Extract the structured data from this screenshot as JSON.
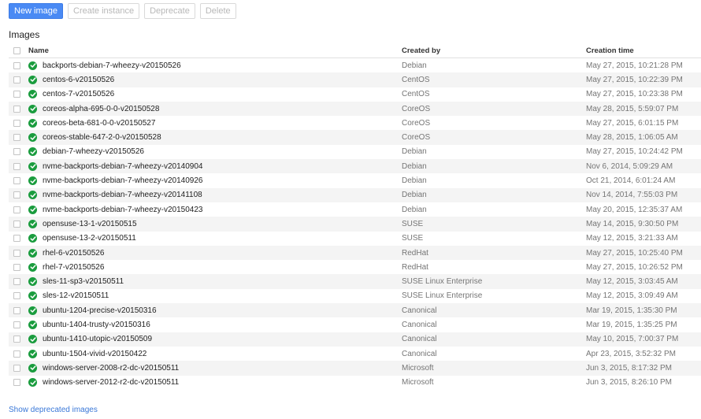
{
  "toolbar": {
    "new_image": "New image",
    "create_instance": "Create instance",
    "deprecate": "Deprecate",
    "delete": "Delete"
  },
  "section_title": "Images",
  "table": {
    "headers": {
      "name": "Name",
      "created_by": "Created by",
      "creation_time": "Creation time"
    },
    "rows": [
      {
        "name": "backports-debian-7-wheezy-v20150526",
        "created_by": "Debian",
        "time": "May 27, 2015, 10:21:28 PM"
      },
      {
        "name": "centos-6-v20150526",
        "created_by": "CentOS",
        "time": "May 27, 2015, 10:22:39 PM"
      },
      {
        "name": "centos-7-v20150526",
        "created_by": "CentOS",
        "time": "May 27, 2015, 10:23:38 PM"
      },
      {
        "name": "coreos-alpha-695-0-0-v20150528",
        "created_by": "CoreOS",
        "time": "May 28, 2015, 5:59:07 PM"
      },
      {
        "name": "coreos-beta-681-0-0-v20150527",
        "created_by": "CoreOS",
        "time": "May 27, 2015, 6:01:15 PM"
      },
      {
        "name": "coreos-stable-647-2-0-v20150528",
        "created_by": "CoreOS",
        "time": "May 28, 2015, 1:06:05 AM"
      },
      {
        "name": "debian-7-wheezy-v20150526",
        "created_by": "Debian",
        "time": "May 27, 2015, 10:24:42 PM"
      },
      {
        "name": "nvme-backports-debian-7-wheezy-v20140904",
        "created_by": "Debian",
        "time": "Nov 6, 2014, 5:09:29 AM"
      },
      {
        "name": "nvme-backports-debian-7-wheezy-v20140926",
        "created_by": "Debian",
        "time": "Oct 21, 2014, 6:01:24 AM"
      },
      {
        "name": "nvme-backports-debian-7-wheezy-v20141108",
        "created_by": "Debian",
        "time": "Nov 14, 2014, 7:55:03 PM"
      },
      {
        "name": "nvme-backports-debian-7-wheezy-v20150423",
        "created_by": "Debian",
        "time": "May 20, 2015, 12:35:37 AM"
      },
      {
        "name": "opensuse-13-1-v20150515",
        "created_by": "SUSE",
        "time": "May 14, 2015, 9:30:50 PM"
      },
      {
        "name": "opensuse-13-2-v20150511",
        "created_by": "SUSE",
        "time": "May 12, 2015, 3:21:33 AM"
      },
      {
        "name": "rhel-6-v20150526",
        "created_by": "RedHat",
        "time": "May 27, 2015, 10:25:40 PM"
      },
      {
        "name": "rhel-7-v20150526",
        "created_by": "RedHat",
        "time": "May 27, 2015, 10:26:52 PM"
      },
      {
        "name": "sles-11-sp3-v20150511",
        "created_by": "SUSE Linux Enterprise",
        "time": "May 12, 2015, 3:03:45 AM"
      },
      {
        "name": "sles-12-v20150511",
        "created_by": "SUSE Linux Enterprise",
        "time": "May 12, 2015, 3:09:49 AM"
      },
      {
        "name": "ubuntu-1204-precise-v20150316",
        "created_by": "Canonical",
        "time": "Mar 19, 2015, 1:35:30 PM"
      },
      {
        "name": "ubuntu-1404-trusty-v20150316",
        "created_by": "Canonical",
        "time": "Mar 19, 2015, 1:35:25 PM"
      },
      {
        "name": "ubuntu-1410-utopic-v20150509",
        "created_by": "Canonical",
        "time": "May 10, 2015, 7:00:37 PM"
      },
      {
        "name": "ubuntu-1504-vivid-v20150422",
        "created_by": "Canonical",
        "time": "Apr 23, 2015, 3:52:32 PM"
      },
      {
        "name": "windows-server-2008-r2-dc-v20150511",
        "created_by": "Microsoft",
        "time": "Jun 3, 2015, 8:17:32 PM"
      },
      {
        "name": "windows-server-2012-r2-dc-v20150511",
        "created_by": "Microsoft",
        "time": "Jun 3, 2015, 8:26:10 PM"
      }
    ],
    "status_icon": "check-circle-icon"
  },
  "footer": {
    "show_deprecated": "Show deprecated images"
  },
  "colors": {
    "primary_button": "#4a8af4",
    "status_ok": "#1a9c3e",
    "link": "#3a78d8"
  }
}
